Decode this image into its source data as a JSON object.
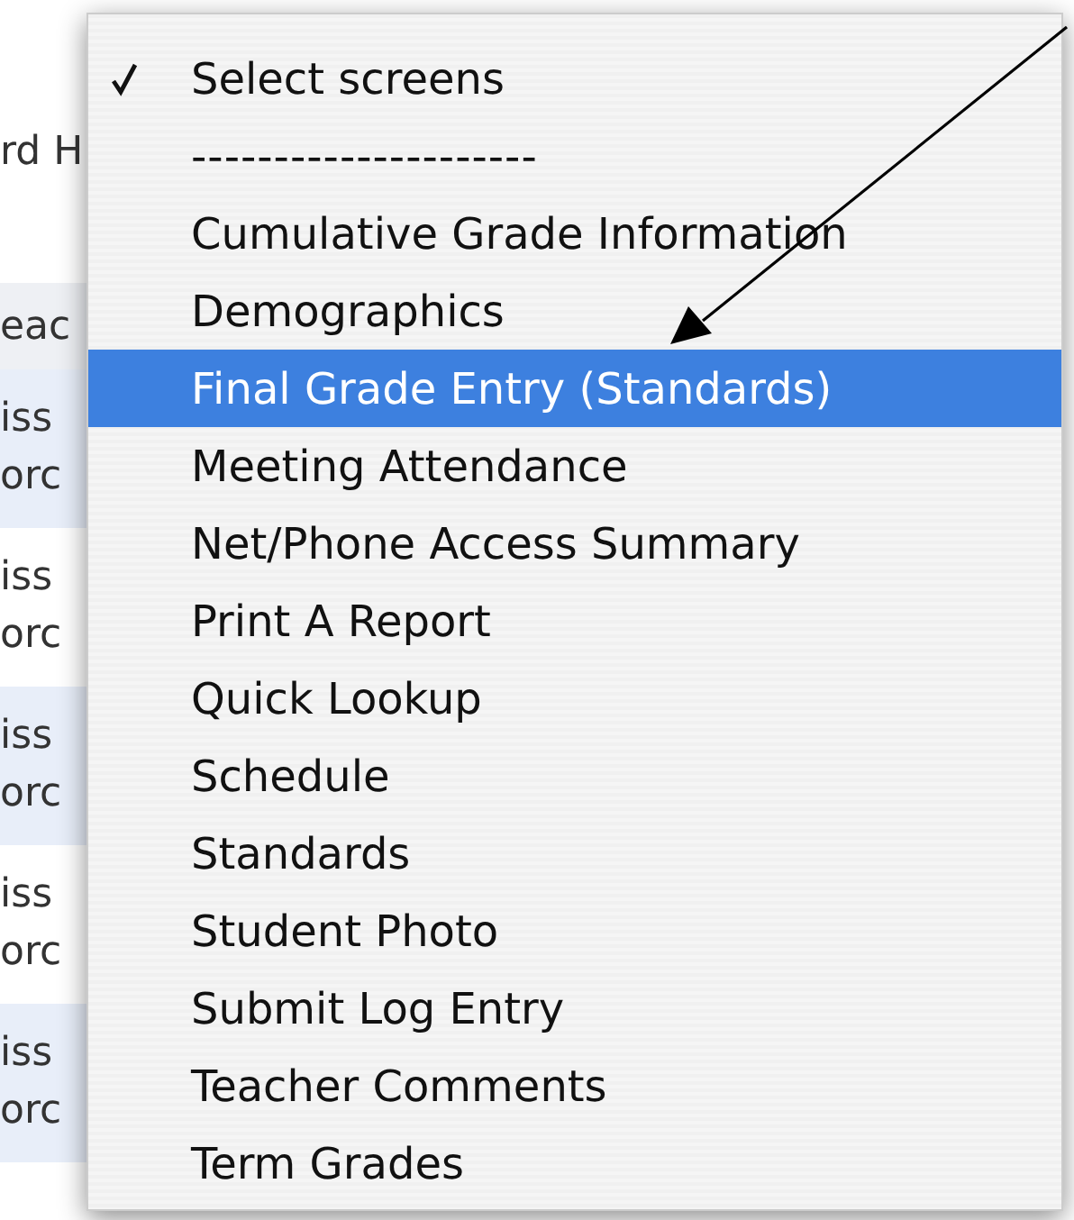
{
  "background": {
    "title_fragment": "rd H",
    "column_header_fragment": "eac",
    "rows": [
      {
        "line_1": "iss",
        "line_2": "orc"
      },
      {
        "line_1": "iss",
        "line_2": "orc"
      },
      {
        "line_1": "iss",
        "line_2": "orc"
      },
      {
        "line_1": "iss",
        "line_2": "orc"
      },
      {
        "line_1": "iss",
        "line_2": "orc"
      }
    ]
  },
  "menu": {
    "items": [
      {
        "kind": "option",
        "label": "Select screens",
        "checked": true,
        "selected": false
      },
      {
        "kind": "separator",
        "label": "---------------------"
      },
      {
        "kind": "option",
        "label": "Cumulative Grade Information",
        "checked": false,
        "selected": false
      },
      {
        "kind": "option",
        "label": "Demographics",
        "checked": false,
        "selected": false
      },
      {
        "kind": "option",
        "label": "Final Grade Entry (Standards)",
        "checked": false,
        "selected": true
      },
      {
        "kind": "option",
        "label": "Meeting Attendance",
        "checked": false,
        "selected": false
      },
      {
        "kind": "option",
        "label": "Net/Phone Access Summary",
        "checked": false,
        "selected": false
      },
      {
        "kind": "option",
        "label": "Print A Report",
        "checked": false,
        "selected": false
      },
      {
        "kind": "option",
        "label": "Quick Lookup",
        "checked": false,
        "selected": false
      },
      {
        "kind": "option",
        "label": "Schedule",
        "checked": false,
        "selected": false
      },
      {
        "kind": "option",
        "label": "Standards",
        "checked": false,
        "selected": false
      },
      {
        "kind": "option",
        "label": "Student Photo",
        "checked": false,
        "selected": false
      },
      {
        "kind": "option",
        "label": "Submit Log Entry",
        "checked": false,
        "selected": false
      },
      {
        "kind": "option",
        "label": "Teacher Comments",
        "checked": false,
        "selected": false
      },
      {
        "kind": "option",
        "label": "Term Grades",
        "checked": false,
        "selected": false
      }
    ]
  }
}
